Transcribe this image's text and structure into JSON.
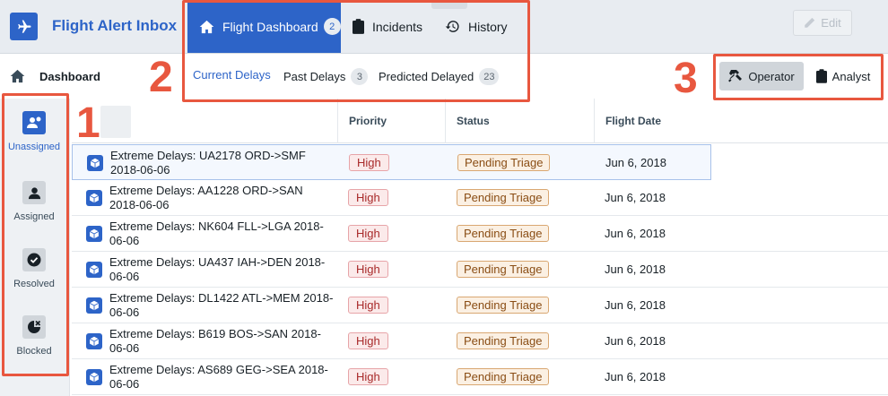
{
  "app": {
    "title": "Flight Alert Inbox"
  },
  "tabs": [
    {
      "label": "Flight Dashboard",
      "count": "2",
      "icon": "home-icon"
    },
    {
      "label": "Incidents",
      "icon": "clipboard-icon"
    },
    {
      "label": "History",
      "icon": "history-icon"
    }
  ],
  "edit_label": "Edit",
  "breadcrumb": {
    "label": "Dashboard"
  },
  "subtabs": [
    {
      "label": "Current Delays"
    },
    {
      "label": "Past Delays",
      "count": "3"
    },
    {
      "label": "Predicted Delayed",
      "count": "23"
    }
  ],
  "roles": [
    {
      "label": "Operator",
      "icon": "hammer-icon"
    },
    {
      "label": "Analyst",
      "icon": "clipboard-icon"
    }
  ],
  "annotations": [
    "1",
    "2",
    "3"
  ],
  "leftnav": [
    {
      "label": "Unassigned",
      "icon": "unassigned-user-icon"
    },
    {
      "label": "Assigned",
      "icon": "user-icon"
    },
    {
      "label": "Resolved",
      "icon": "check-circle-icon"
    },
    {
      "label": "Blocked",
      "icon": "blocked-icon"
    }
  ],
  "table": {
    "headers": [
      "Priority",
      "Status",
      "Flight Date"
    ],
    "rows": [
      {
        "name": "Extreme Delays: UA2178 ORD->SMF 2018-06-06",
        "priority": "High",
        "status": "Pending Triage",
        "date": "Jun 6, 2018"
      },
      {
        "name": "Extreme Delays: AA1228 ORD->SAN 2018-06-06",
        "priority": "High",
        "status": "Pending Triage",
        "date": "Jun 6, 2018"
      },
      {
        "name": "Extreme Delays: NK604 FLL->LGA 2018-06-06",
        "priority": "High",
        "status": "Pending Triage",
        "date": "Jun 6, 2018"
      },
      {
        "name": "Extreme Delays: UA437 IAH->DEN 2018-06-06",
        "priority": "High",
        "status": "Pending Triage",
        "date": "Jun 6, 2018"
      },
      {
        "name": "Extreme Delays: DL1422 ATL->MEM 2018-06-06",
        "priority": "High",
        "status": "Pending Triage",
        "date": "Jun 6, 2018"
      },
      {
        "name": "Extreme Delays: B619 BOS->SAN 2018-06-06",
        "priority": "High",
        "status": "Pending Triage",
        "date": "Jun 6, 2018"
      },
      {
        "name": "Extreme Delays: AS689 GEG->SEA 2018-06-06",
        "priority": "High",
        "status": "Pending Triage",
        "date": "Jun 6, 2018"
      }
    ]
  },
  "colors": {
    "accent": "#2d64c8",
    "annotation": "#e8573f"
  }
}
